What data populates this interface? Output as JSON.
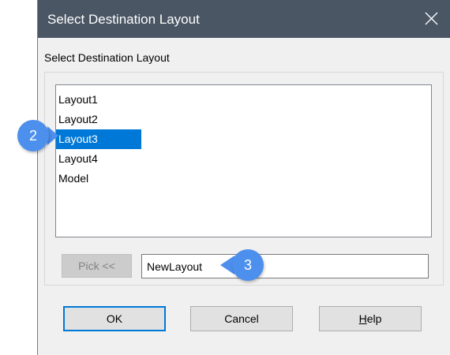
{
  "dialog": {
    "title": "Select Destination Layout",
    "close_icon": "close-icon",
    "section_label": "Select Destination Layout",
    "layouts": [
      {
        "label": "Layout1",
        "selected": false
      },
      {
        "label": "Layout2",
        "selected": false
      },
      {
        "label": "Layout3",
        "selected": true
      },
      {
        "label": "Layout4",
        "selected": false
      },
      {
        "label": "Model",
        "selected": false
      }
    ],
    "pick_button": {
      "label": "Pick <<",
      "enabled": false
    },
    "layout_name_input": {
      "value": "NewLayout"
    },
    "buttons": {
      "ok": "OK",
      "cancel": "Cancel",
      "help_mnemonic": "H",
      "help_rest": "elp"
    }
  },
  "callouts": [
    {
      "number": "2",
      "target": "Layout3"
    },
    {
      "number": "3",
      "target": "layout name field"
    }
  ],
  "colors": {
    "titlebar": "#4a5664",
    "selection": "#0078d7",
    "callout": "#4d8fec",
    "dialog_background": "#f0f0f0"
  }
}
